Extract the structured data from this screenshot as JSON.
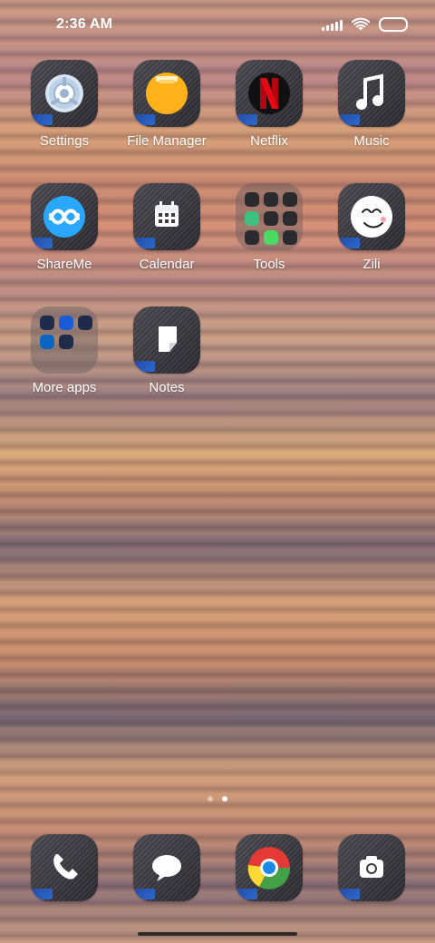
{
  "status_bar": {
    "time": "2:36 AM",
    "icons": [
      "signal-icon",
      "wifi-icon",
      "battery-icon"
    ]
  },
  "apps": [
    {
      "label": "Settings",
      "icon": "settings-icon"
    },
    {
      "label": "File Manager",
      "icon": "file-manager-icon"
    },
    {
      "label": "Netflix",
      "icon": "netflix-icon"
    },
    {
      "label": "Music",
      "icon": "music-note-icon"
    },
    {
      "label": "ShareMe",
      "icon": "shareme-icon"
    },
    {
      "label": "Calendar",
      "icon": "calendar-icon"
    },
    {
      "label": "Tools",
      "icon": "folder-icon"
    },
    {
      "label": "Zili",
      "icon": "zili-face-icon"
    },
    {
      "label": "More apps",
      "icon": "folder-icon"
    },
    {
      "label": "Notes",
      "icon": "notes-icon"
    }
  ],
  "page_indicator": {
    "pages": 2,
    "active": 2
  },
  "dock": [
    {
      "icon": "phone-icon"
    },
    {
      "icon": "messages-icon"
    },
    {
      "icon": "chrome-icon"
    },
    {
      "icon": "camera-icon"
    }
  ],
  "colors": {
    "netflix": "#E50914",
    "shareme": "#2aa7ff",
    "file_manager": "#ffb21a"
  }
}
